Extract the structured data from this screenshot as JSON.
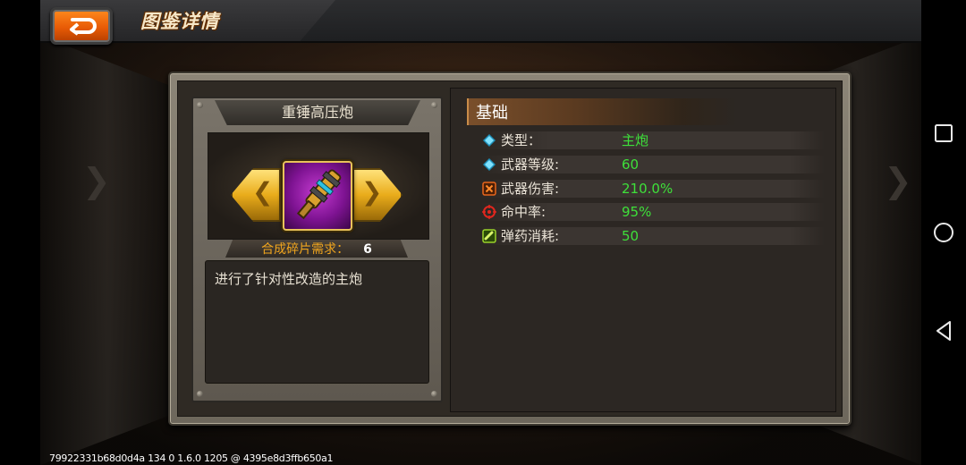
{
  "header": {
    "title": "图鉴详情",
    "back_icon": "back-arrow-icon"
  },
  "weapon": {
    "name": "重锤高压炮",
    "icon": "cannon-weapon-icon",
    "fragment_label": "合成碎片需求：",
    "fragment_count": "6",
    "description": "进行了针对性改造的主炮"
  },
  "stats": {
    "section_title": "基础",
    "rows": [
      {
        "icon": "blue-diamond-icon",
        "label": "类型：",
        "value": "主炮"
      },
      {
        "icon": "blue-diamond-icon",
        "label": "武器等级:",
        "value": "60"
      },
      {
        "icon": "orange-cross-icon",
        "label": "武器伤害:",
        "value": "210.0%"
      },
      {
        "icon": "red-crosshair-icon",
        "label": "命中率:",
        "value": "95%"
      },
      {
        "icon": "green-ammo-icon",
        "label": "弹药消耗:",
        "value": "50"
      }
    ]
  },
  "debug": {
    "text": "79922331b68d0d4a 134 0 1.6.0 1205 @ 4395e8d3ffb650a1"
  },
  "navigation": {
    "recents": "square-recents-icon",
    "home": "circle-home-icon",
    "back": "triangle-back-icon"
  },
  "colors": {
    "accent_orange": "#e85b06",
    "value_green": "#3ee03a",
    "fragment_gold": "#f0a51e",
    "rarity_purple": "#7e1392"
  }
}
